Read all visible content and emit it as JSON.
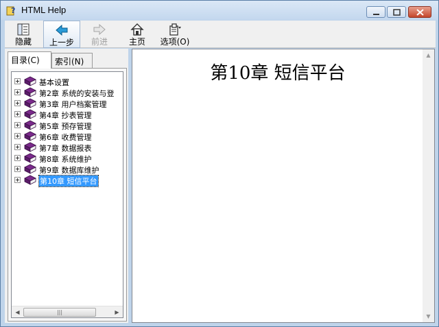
{
  "window": {
    "title": "HTML Help"
  },
  "titlebar_icons": {
    "app": "help-book-question-icon",
    "min": "minimize-icon",
    "max": "maximize-icon",
    "close": "close-icon"
  },
  "toolbar": {
    "hide": {
      "label": "隐藏",
      "icon": "hide-pane-icon"
    },
    "back": {
      "label": "上一步",
      "icon": "back-arrow-icon"
    },
    "forward": {
      "label": "前进",
      "icon": "forward-arrow-icon"
    },
    "home": {
      "label": "主页",
      "icon": "home-icon"
    },
    "options": {
      "label": "选项(O)",
      "icon": "options-icon"
    }
  },
  "tabs": {
    "contents": "目录(C)",
    "index": "索引(N)"
  },
  "tree": [
    {
      "label": "基本设置"
    },
    {
      "label": "第2章  系统的安装与登"
    },
    {
      "label": "第3章   用户档案管理"
    },
    {
      "label": "第4章   抄表管理"
    },
    {
      "label": "第5章   预存管理"
    },
    {
      "label": "第6章   收费管理"
    },
    {
      "label": "第7章   数据报表"
    },
    {
      "label": "第8章   系统维护"
    },
    {
      "label": "第9章   数据库维护"
    },
    {
      "label": "第10章  短信平台",
      "selected": true
    }
  ],
  "content": {
    "title": "第10章  短信平台"
  },
  "colors": {
    "book": "#7b2a8c",
    "selection": "#3399ff",
    "close": "#c5462c"
  }
}
